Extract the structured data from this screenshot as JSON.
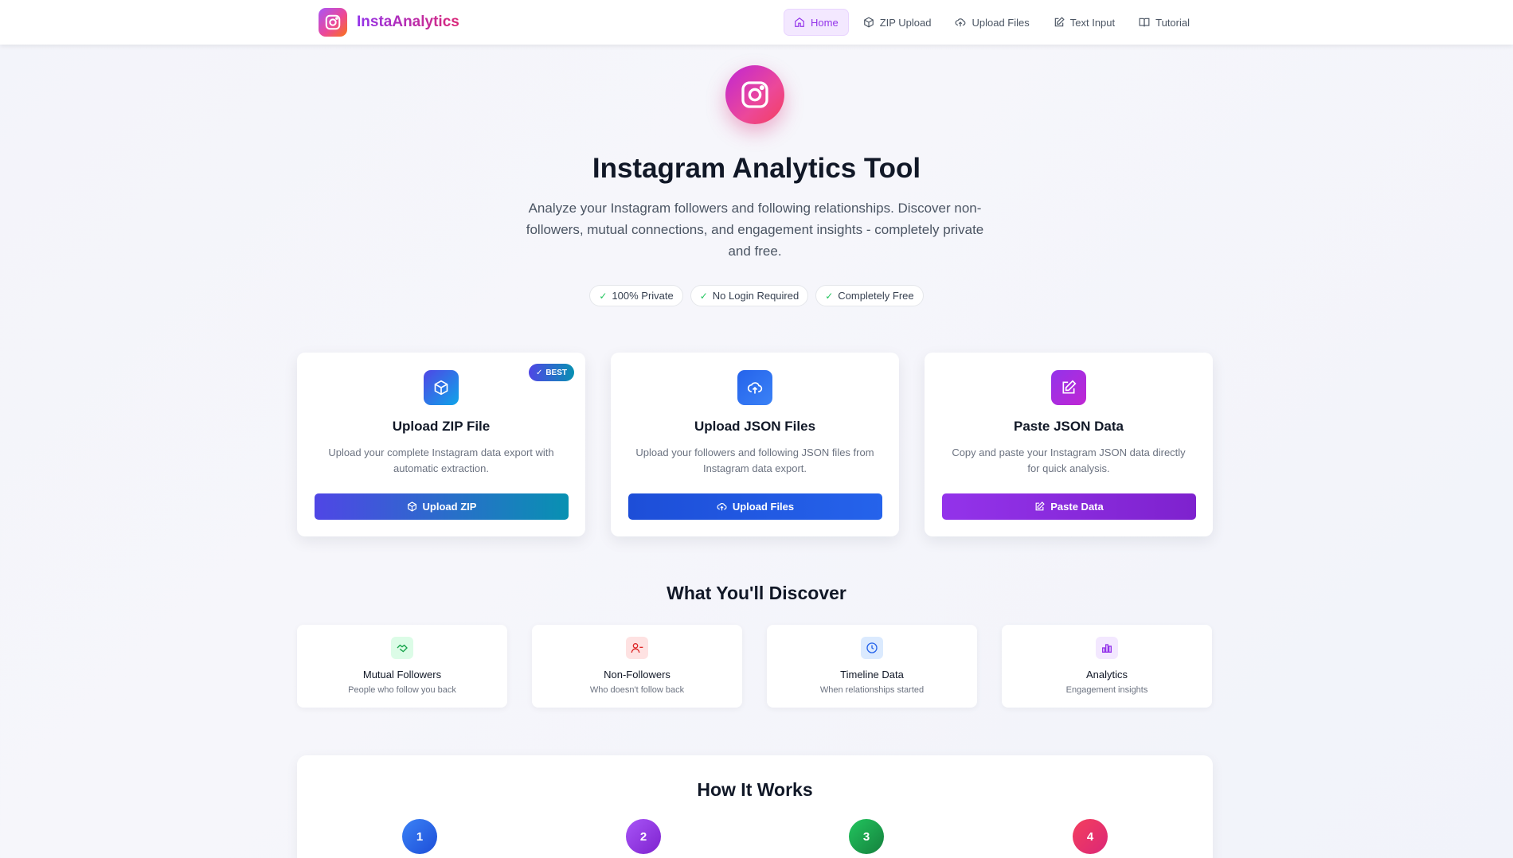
{
  "brand": {
    "name": "InstaAnalytics"
  },
  "nav": {
    "items": [
      {
        "label": "Home",
        "icon": "home-icon",
        "active": true
      },
      {
        "label": "ZIP Upload",
        "icon": "box-icon",
        "active": false
      },
      {
        "label": "Upload Files",
        "icon": "cloud-upload-icon",
        "active": false
      },
      {
        "label": "Text Input",
        "icon": "edit-icon",
        "active": false
      },
      {
        "label": "Tutorial",
        "icon": "book-icon",
        "active": false
      }
    ]
  },
  "hero": {
    "title": "Instagram Analytics Tool",
    "subtitle": "Analyze your Instagram followers and following relationships. Discover non-followers, mutual connections, and engagement insights - completely private and free.",
    "badges": [
      "100% Private",
      "No Login Required",
      "Completely Free"
    ]
  },
  "methods": [
    {
      "title": "Upload ZIP File",
      "description": "Upload your complete Instagram data export with automatic extraction.",
      "button": "Upload ZIP",
      "badge": "BEST",
      "icon": "box-icon",
      "accent": "#4f46e5"
    },
    {
      "title": "Upload JSON Files",
      "description": "Upload your followers and following JSON files from Instagram data export.",
      "button": "Upload Files",
      "icon": "cloud-upload-icon",
      "accent": "#2563eb"
    },
    {
      "title": "Paste JSON Data",
      "description": "Copy and paste your Instagram JSON data directly for quick analysis.",
      "button": "Paste Data",
      "icon": "edit-icon",
      "accent": "#9333ea"
    }
  ],
  "discover": {
    "title": "What You'll Discover",
    "items": [
      {
        "title": "Mutual Followers",
        "subtitle": "People who follow you back",
        "icon": "handshake-icon",
        "color": "#16a34a"
      },
      {
        "title": "Non-Followers",
        "subtitle": "Who doesn't follow back",
        "icon": "user-minus-icon",
        "color": "#dc2626"
      },
      {
        "title": "Timeline Data",
        "subtitle": "When relationships started",
        "icon": "clock-icon",
        "color": "#2563eb"
      },
      {
        "title": "Analytics",
        "subtitle": "Engagement insights",
        "icon": "bar-chart-icon",
        "color": "#9333ea"
      }
    ]
  },
  "how": {
    "title": "How It Works",
    "steps": [
      "1",
      "2",
      "3",
      "4"
    ]
  }
}
